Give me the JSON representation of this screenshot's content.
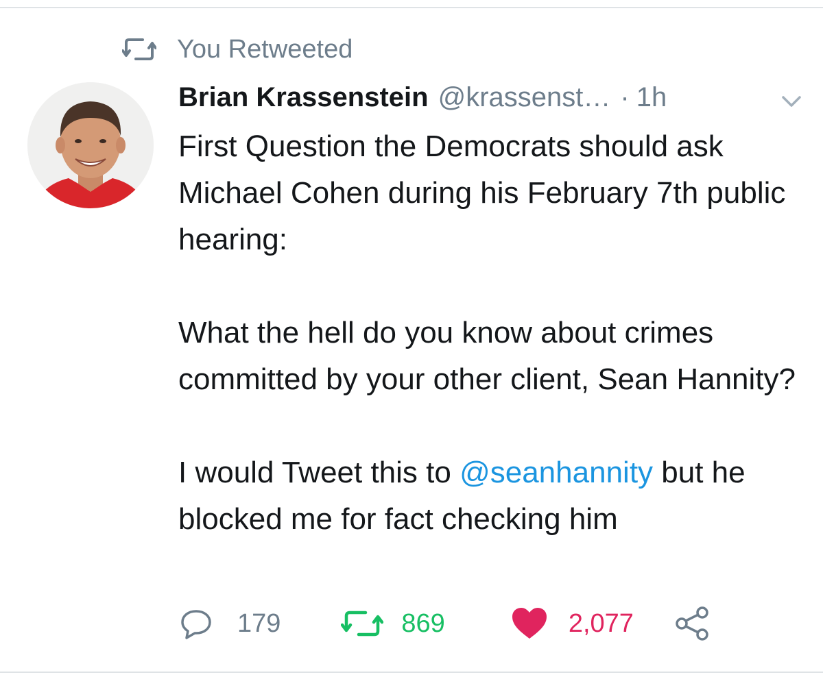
{
  "retweet_context": {
    "label": "You Retweeted",
    "icon": "retweet-icon"
  },
  "author": {
    "name": "Brian Krassenstein",
    "handle": "@krassenst…",
    "separator": "·",
    "time": "1h",
    "menu_icon": "chevron-down-icon"
  },
  "tweet": {
    "line1": "First Question the Democrats should ask Michael Cohen during his February 7th public hearing:",
    "line2": "What the hell do you know about crimes committed by your other client, Sean Hannity?",
    "line3_before": "I would Tweet this to ",
    "line3_mention": "@seanhannity",
    "line3_after": " but he blocked me for fact checking him"
  },
  "actions": {
    "replies": "179",
    "retweets": "869",
    "likes": "2,077",
    "icons": [
      "reply-icon",
      "retweet-icon",
      "heart-icon",
      "share-icon"
    ]
  },
  "colors": {
    "text": "#14171a",
    "secondary": "#6d7d8b",
    "link": "#1b95e0",
    "retweet": "#17bf63",
    "like": "#e0245e"
  }
}
